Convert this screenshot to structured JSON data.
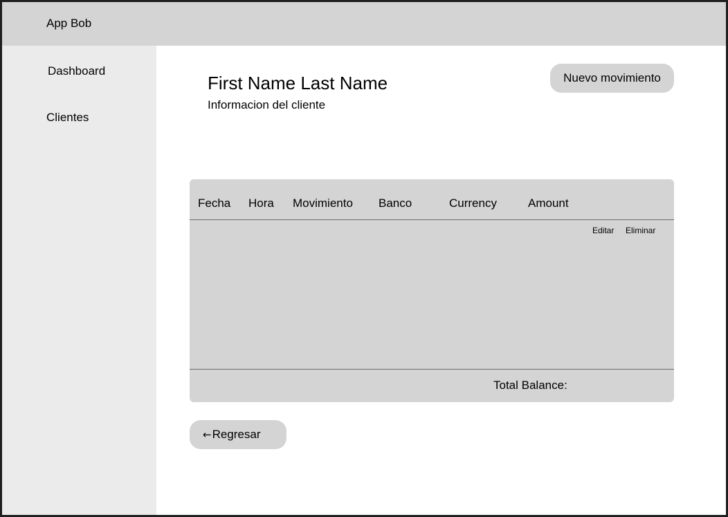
{
  "app": {
    "title": "App Bob"
  },
  "sidebar": {
    "items": [
      {
        "label": "Dashboard"
      },
      {
        "label": "Clientes"
      }
    ]
  },
  "client": {
    "name": "First Name Last Name",
    "subtitle": "Informacion del cliente"
  },
  "actions": {
    "new_movement_label": "Nuevo movimiento",
    "back_arrow": "←",
    "back_label": "Regresar"
  },
  "table": {
    "columns": [
      "Fecha",
      "Hora",
      "Movimiento",
      "Banco",
      "Currency",
      "Amount"
    ],
    "row_actions": {
      "edit_label": "Editar",
      "delete_label": "Eliminar"
    },
    "total_label": "Total Balance:"
  },
  "colors": {
    "topbar": "#d4d4d4",
    "sidebar": "#ebebeb",
    "card": "#d4d4d4",
    "border": "#1e1e1e"
  },
  "icons": {
    "back": "arrow-left-icon"
  }
}
